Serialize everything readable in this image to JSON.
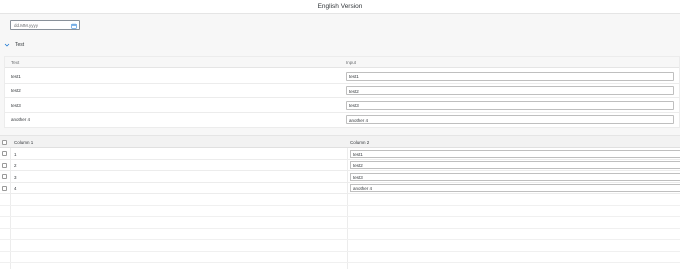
{
  "shell": {
    "title": "English Version"
  },
  "date_picker": {
    "placeholder": "dd.MM.yyyy",
    "icon": "calendar-icon"
  },
  "panel": {
    "title": "Test",
    "expanded": true
  },
  "form_table": {
    "columns": [
      "Text",
      "Input"
    ],
    "rows": [
      {
        "text": "test1",
        "input": "test1"
      },
      {
        "text": "test2",
        "input": "test2"
      },
      {
        "text": "test3",
        "input": "test3"
      },
      {
        "text": "another 4",
        "input": "another 4"
      }
    ]
  },
  "grid_table": {
    "columns": [
      "Column 1",
      "Column 2"
    ],
    "rows": [
      {
        "col1": "1",
        "col2": "test1"
      },
      {
        "col1": "2",
        "col2": "test2"
      },
      {
        "col1": "3",
        "col2": "test3"
      },
      {
        "col1": "4",
        "col2": "another 4"
      }
    ]
  }
}
